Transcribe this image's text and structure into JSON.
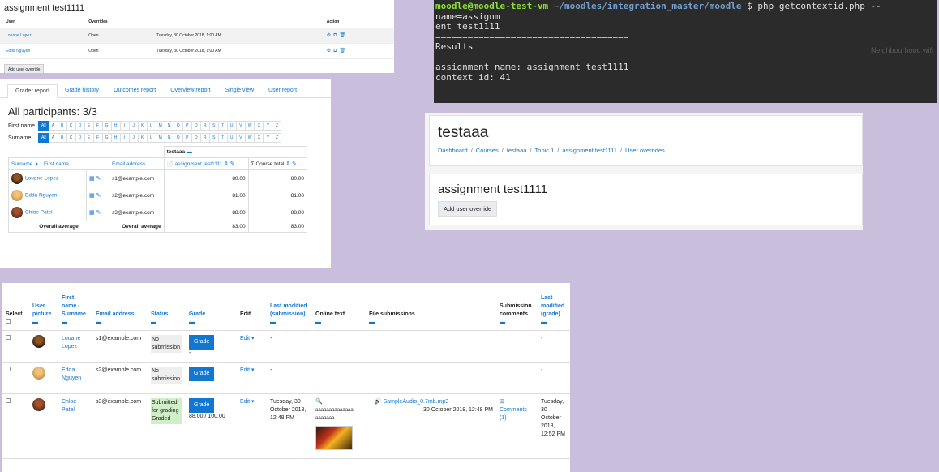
{
  "overrides": {
    "title": "assignment test1111",
    "headers": [
      "User",
      "Overrides",
      "",
      "Action"
    ],
    "rows": [
      {
        "user": "Louane Lopez",
        "override": "Open",
        "date": "Tuesday, 30 October 2018, 1:00 AM"
      },
      {
        "user": "Edda Nguyen",
        "override": "Open",
        "date": "Tuesday, 30 October 2018, 1:00 AM"
      }
    ],
    "add_button": "Add user override"
  },
  "grader": {
    "tabs": [
      "Grader report",
      "Grade history",
      "Outcomes report",
      "Overview report",
      "Single view",
      "User report"
    ],
    "heading": "All participants: 3/3",
    "first_name_label": "First name",
    "surname_label": "Surname",
    "letters": [
      "All",
      "A",
      "B",
      "C",
      "D",
      "E",
      "F",
      "G",
      "H",
      "I",
      "J",
      "K",
      "L",
      "M",
      "N",
      "O",
      "P",
      "Q",
      "R",
      "S",
      "T",
      "U",
      "V",
      "W",
      "X",
      "Y",
      "Z"
    ],
    "course_label": "testaaa",
    "col_surname": "Surname",
    "col_firstname": "First name",
    "col_email": "Email address",
    "col_assignment": "assignment test1111",
    "col_total": "Course total",
    "rows": [
      {
        "name": "Louane Lopez",
        "email": "s1@example.com",
        "grade": "80.00",
        "total": "80.00"
      },
      {
        "name": "Edda Nguyen",
        "email": "s2@example.com",
        "grade": "81.00",
        "total": "81.00"
      },
      {
        "name": "Chloe Patel",
        "email": "s3@example.com",
        "grade": "88.00",
        "total": "88.00"
      }
    ],
    "avg_label": "Overall average",
    "avg_grade": "83.00",
    "avg_total": "83.00"
  },
  "terminal": {
    "prompt": "moodle@moodle-test-vm",
    "path": "~/moodles/integration_master/moodle",
    "command": "$ php getcontextid.php --name=assignm",
    "command_wrap": "ent test1111",
    "separator": "====================================",
    "results": "Results",
    "line1": "assignment name: assignment test1111",
    "line2": "context id: 41",
    "ghost": "Neighbourhood wifi"
  },
  "course": {
    "title": "testaaa",
    "breadcrumbs": [
      "Dashboard",
      "Courses",
      "testaaa",
      "Topic 1",
      "assignment test1111",
      "User overrides"
    ],
    "assignment_title": "assignment test1111",
    "add_button": "Add user override"
  },
  "submissions": {
    "headers": {
      "select": "Select",
      "picture": "User picture",
      "name": "First name / Surname",
      "email": "Email address",
      "status": "Status",
      "grade": "Grade",
      "edit": "Edit",
      "last_sub": "Last modified (submission)",
      "online": "Online text",
      "files": "File submissions",
      "comments": "Submission comments",
      "last_grade": "Last modified (grade)"
    },
    "rows": [
      {
        "first": "Louane",
        "last": "Lopez",
        "email": "s1@example.com",
        "status": "No submission",
        "grade_btn": "Grade",
        "grade_val": "-",
        "edit": "Edit",
        "modified": "-",
        "grade_mod": "-"
      },
      {
        "first": "Edda",
        "last": "Nguyen",
        "email": "s2@example.com",
        "status": "No submission",
        "grade_btn": "Grade",
        "grade_val": "-",
        "edit": "Edit",
        "modified": "-",
        "grade_mod": "-"
      },
      {
        "first": "Chloe",
        "last": "Patel",
        "email": "s3@example.com",
        "status": "Submitted for grading Graded",
        "grade_btn": "Grade",
        "grade_val": "88.00 / 100.00",
        "edit": "Edit",
        "modified": "Tuesday, 30 October 2018, 12:48 PM",
        "online_text": "aaaaaaaaaaaaaa aaaaaaa",
        "file": "SampleAudio_0.7mb.mp3",
        "file_date": "30 October 2018, 12:48 PM",
        "comments": "Comments (1)",
        "grade_mod": "Tuesday, 30 October 2018, 12:52 PM"
      }
    ]
  }
}
